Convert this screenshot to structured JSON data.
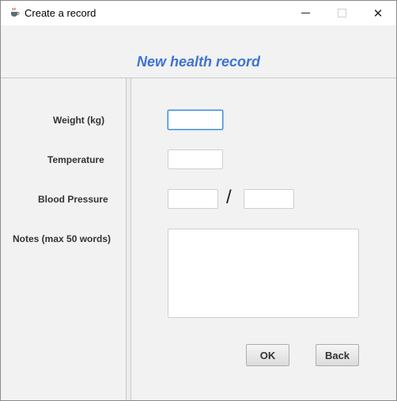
{
  "window": {
    "title": "Create a record",
    "app_icon": "java-cup-icon",
    "controls": {
      "minimize": "minimize-icon",
      "maximize": "maximize-icon",
      "close": "close-icon",
      "close_glyph": "✕"
    }
  },
  "header": {
    "title": "New health record"
  },
  "form": {
    "weight_label": "Weight (kg)",
    "weight_value": "",
    "temperature_label": "Temperature",
    "temperature_value": "",
    "bp_label": "Blood Pressure",
    "bp_separator": "/",
    "bp_systolic_value": "",
    "bp_diastolic_value": "",
    "notes_label": "Notes (max 50 words)",
    "notes_value": ""
  },
  "buttons": {
    "ok_label": "OK",
    "back_label": "Back"
  },
  "colors": {
    "heading": "#3e73d6",
    "focus_border": "#3c8bd9"
  }
}
